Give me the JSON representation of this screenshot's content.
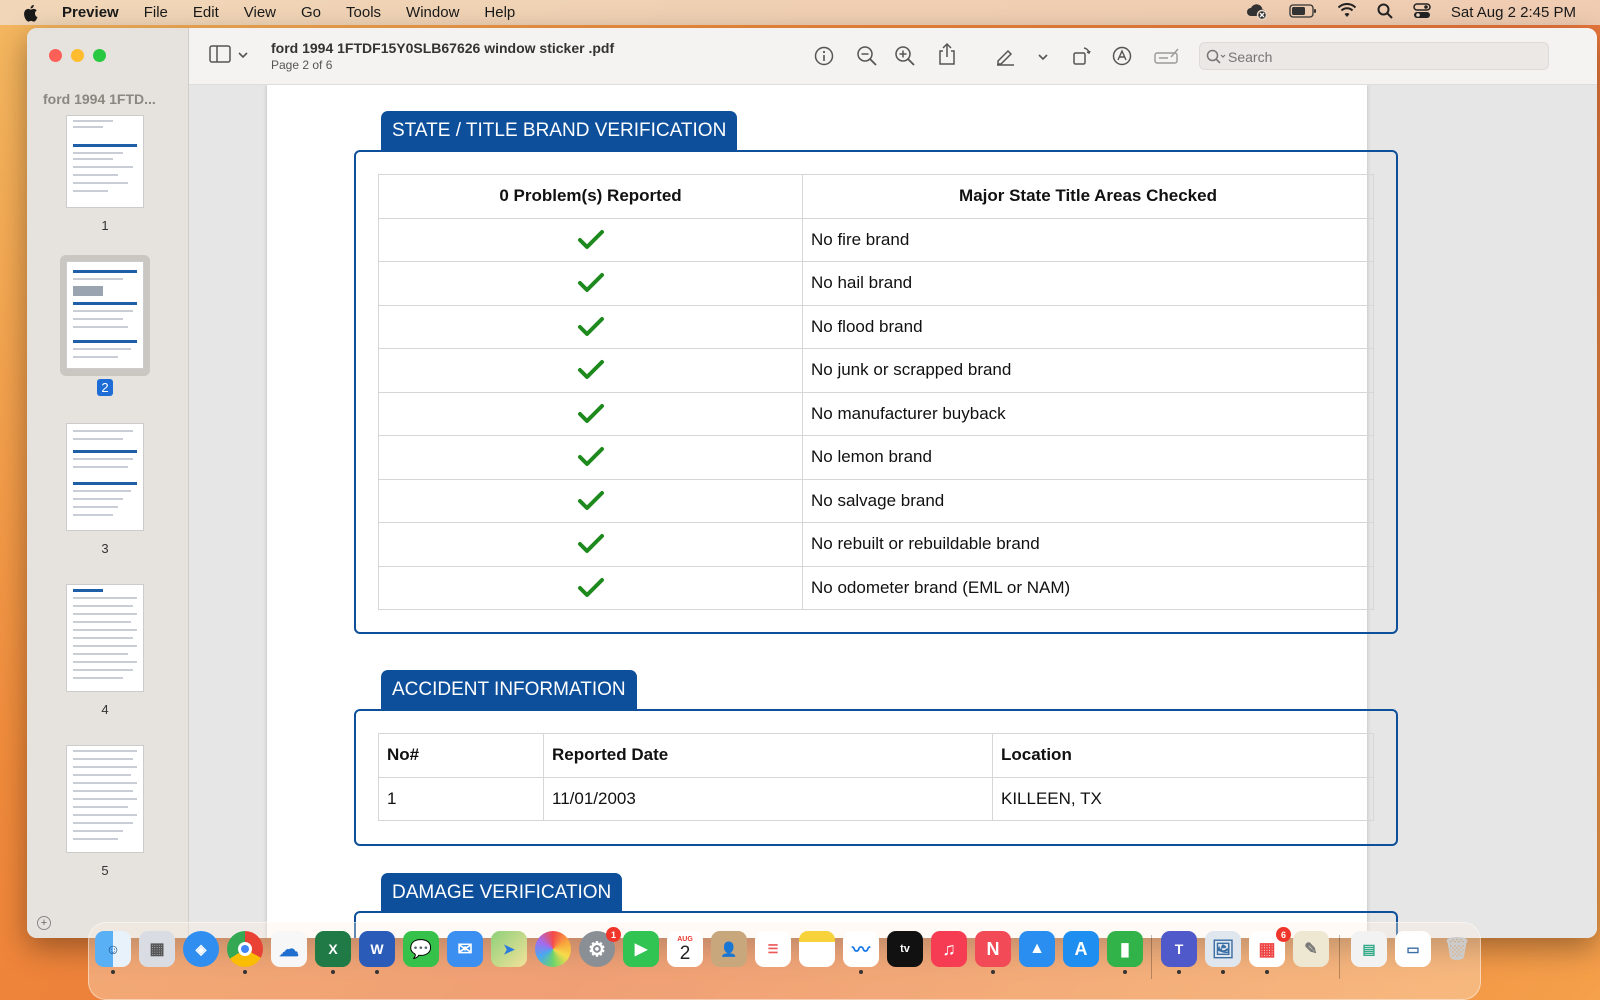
{
  "menubar": {
    "app": "Preview",
    "items": [
      "File",
      "Edit",
      "View",
      "Go",
      "Tools",
      "Window",
      "Help"
    ],
    "clock": "Sat Aug 2  2:45 PM"
  },
  "window": {
    "sidebar_title": "ford 1994 1FTD...",
    "doc_title": "ford 1994 1FTDF15Y0SLB67626 window sticker .pdf",
    "doc_subtitle": "Page 2 of 6",
    "search_placeholder": "Search",
    "thumbnails": [
      "1",
      "2",
      "3",
      "4",
      "5"
    ],
    "selected_page": "2"
  },
  "brand_section": {
    "title": "STATE / TITLE BRAND VERIFICATION",
    "col1": "0 Problem(s) Reported",
    "col2": "Major State Title Areas Checked",
    "rows": [
      "No fire brand",
      "No hail brand",
      "No flood brand",
      "No junk or scrapped brand",
      "No manufacturer buyback",
      "No lemon brand",
      "No salvage brand",
      "No rebuilt or rebuildable brand",
      "No odometer brand (EML or NAM)"
    ]
  },
  "accident_section": {
    "title": "ACCIDENT INFORMATION",
    "headers": [
      "No#",
      "Reported Date",
      "Location"
    ],
    "rows": [
      [
        "1",
        "11/01/2003",
        "KILLEEN, TX"
      ]
    ]
  },
  "damage_section": {
    "title": "DAMAGE VERIFICATION"
  },
  "dock": {
    "calendar_month": "AUG",
    "calendar_day": "2",
    "settings_badge": "1",
    "office_badge": "6"
  },
  "colors": {
    "section_blue": "#0d4f9a",
    "check_green": "#1e8a1e"
  }
}
